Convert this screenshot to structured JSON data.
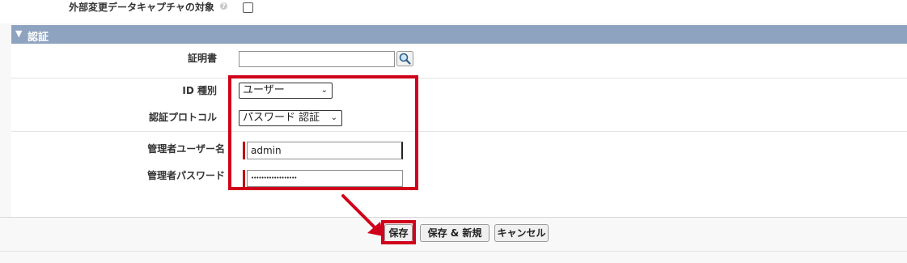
{
  "top_field": {
    "label": "外部変更データキャプチャの対象",
    "help": "?"
  },
  "section": {
    "title": "認証",
    "arrow": "▼"
  },
  "fields": {
    "certificate": {
      "label": "証明書",
      "value": ""
    },
    "identity_type": {
      "label": "ID 種別",
      "value": "ユーザー"
    },
    "auth_protocol": {
      "label": "認証プロトコル",
      "value": "パスワード 認証"
    },
    "admin_user": {
      "label": "管理者ユーザー名",
      "value": "admin"
    },
    "admin_password": {
      "label": "管理者パスワード",
      "value": "••••••••••••••••••"
    }
  },
  "buttons": {
    "save": "保存",
    "save_new": "保存 & 新規",
    "cancel": "キャンセル"
  },
  "colors": {
    "section_bar": "#8ea3c0",
    "highlight": "#d0021b",
    "required": "#c00000"
  }
}
